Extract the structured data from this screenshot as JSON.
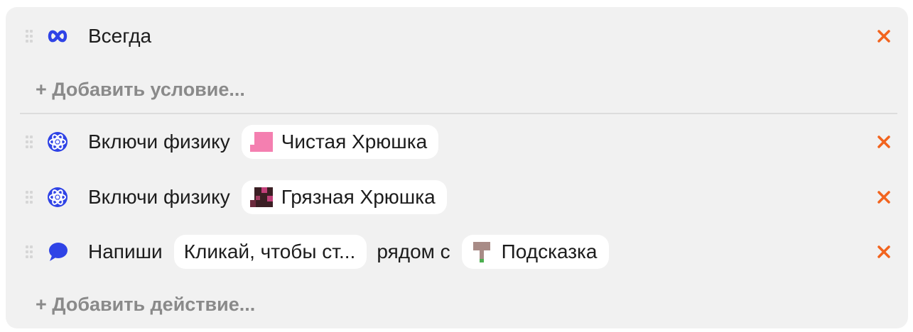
{
  "conditions": {
    "items": [
      {
        "label": "Всегда",
        "icon": "infinity-icon"
      }
    ],
    "add_label": "+ Добавить условие..."
  },
  "actions": {
    "items": [
      {
        "verb": "Включи физику",
        "icon": "atom-icon",
        "target": "Чистая Хрюшка",
        "target_icon": "clean-pig-sprite"
      },
      {
        "verb": "Включи физику",
        "icon": "atom-icon",
        "target": "Грязная Хрюшка",
        "target_icon": "dirty-pig-sprite"
      },
      {
        "verb": "Напиши",
        "icon": "speech-bubble-icon",
        "message": "Кликай, чтобы ст...",
        "connector": "рядом с",
        "target": "Подсказка",
        "target_icon": "sign-sprite"
      }
    ],
    "add_label": "+ Добавить действие..."
  },
  "colors": {
    "panel_bg": "#f1f1f1",
    "chip_bg": "#ffffff",
    "icon_blue": "#2f43e6",
    "delete_orange": "#f2641e",
    "muted_text": "#8a8a8a"
  }
}
